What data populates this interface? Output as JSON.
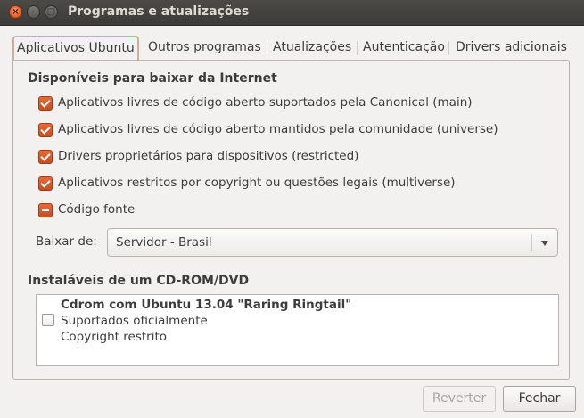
{
  "window": {
    "title": "Programas e atualizações",
    "controls": {
      "close": "×",
      "minimize": "–",
      "maximize": "□"
    }
  },
  "tabs": [
    {
      "label": "Aplicativos Ubuntu",
      "active": true
    },
    {
      "label": "Outros programas",
      "active": false
    },
    {
      "label": "Atualizações",
      "active": false
    },
    {
      "label": "Autenticação",
      "active": false
    },
    {
      "label": "Drivers adicionais",
      "active": false
    }
  ],
  "internet": {
    "title": "Disponíveis para baixar da Internet",
    "items": [
      {
        "label": "Aplicativos livres de código aberto suportados pela Canonical (main)",
        "state": "checked"
      },
      {
        "label": "Aplicativos livres de código aberto mantidos pela comunidade (universe)",
        "state": "checked"
      },
      {
        "label": "Drivers proprietários para dispositivos (restricted)",
        "state": "checked"
      },
      {
        "label": "Aplicativos restritos por copyright ou questões legais (multiverse)",
        "state": "checked"
      },
      {
        "label": "Código fonte",
        "state": "mixed"
      }
    ],
    "download_label": "Baixar de:",
    "download_value": "Servidor - Brasil"
  },
  "cdrom": {
    "title": "Instaláveis de um CD-ROM/DVD",
    "entry": {
      "name": "Cdrom com Ubuntu 13.04 \"Raring Ringtail\"",
      "line2": "Suportados oficialmente",
      "line3": "Copyright restrito",
      "checked": false
    }
  },
  "buttons": {
    "revert": "Reverter",
    "close": "Fechar"
  },
  "colors": {
    "accent": "#dd4814",
    "titlebar": "#3c3b37"
  }
}
